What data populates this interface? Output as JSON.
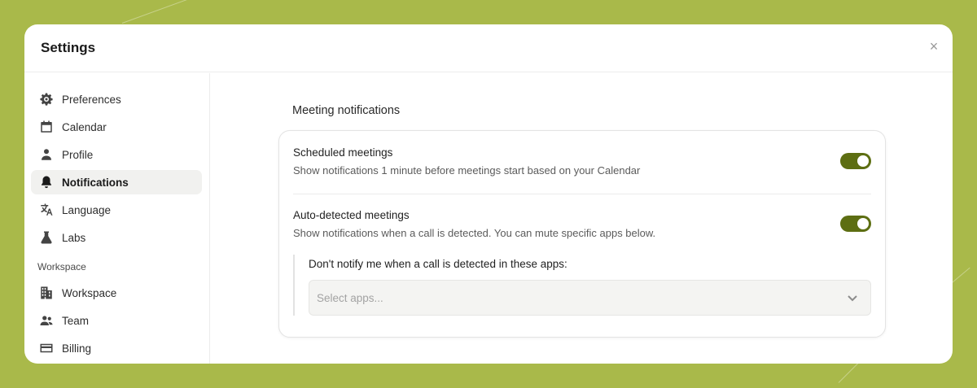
{
  "modal": {
    "title": "Settings",
    "close_glyph": "×"
  },
  "sidebar": {
    "items": [
      {
        "label": "Preferences",
        "icon": "gear-icon"
      },
      {
        "label": "Calendar",
        "icon": "calendar-icon"
      },
      {
        "label": "Profile",
        "icon": "person-icon"
      },
      {
        "label": "Notifications",
        "icon": "bell-icon",
        "active": true
      },
      {
        "label": "Language",
        "icon": "translate-icon"
      },
      {
        "label": "Labs",
        "icon": "flask-icon"
      }
    ],
    "workspace_section_label": "Workspace",
    "workspace_items": [
      {
        "label": "Workspace",
        "icon": "building-icon"
      },
      {
        "label": "Team",
        "icon": "team-icon"
      },
      {
        "label": "Billing",
        "icon": "credit-card-icon"
      }
    ]
  },
  "main": {
    "heading": "Meeting notifications",
    "scheduled": {
      "title": "Scheduled meetings",
      "description": "Show notifications 1 minute before meetings start based on your Calendar",
      "enabled": true
    },
    "auto_detected": {
      "title": "Auto-detected meetings",
      "description": "Show notifications when a call is detected. You can mute specific apps below.",
      "enabled": true
    },
    "mute_apps": {
      "label": "Don't notify me when a call is detected in these apps:",
      "placeholder": "Select apps..."
    }
  },
  "colors": {
    "background": "#a9b94a",
    "toggle_on": "#5d6e12"
  }
}
